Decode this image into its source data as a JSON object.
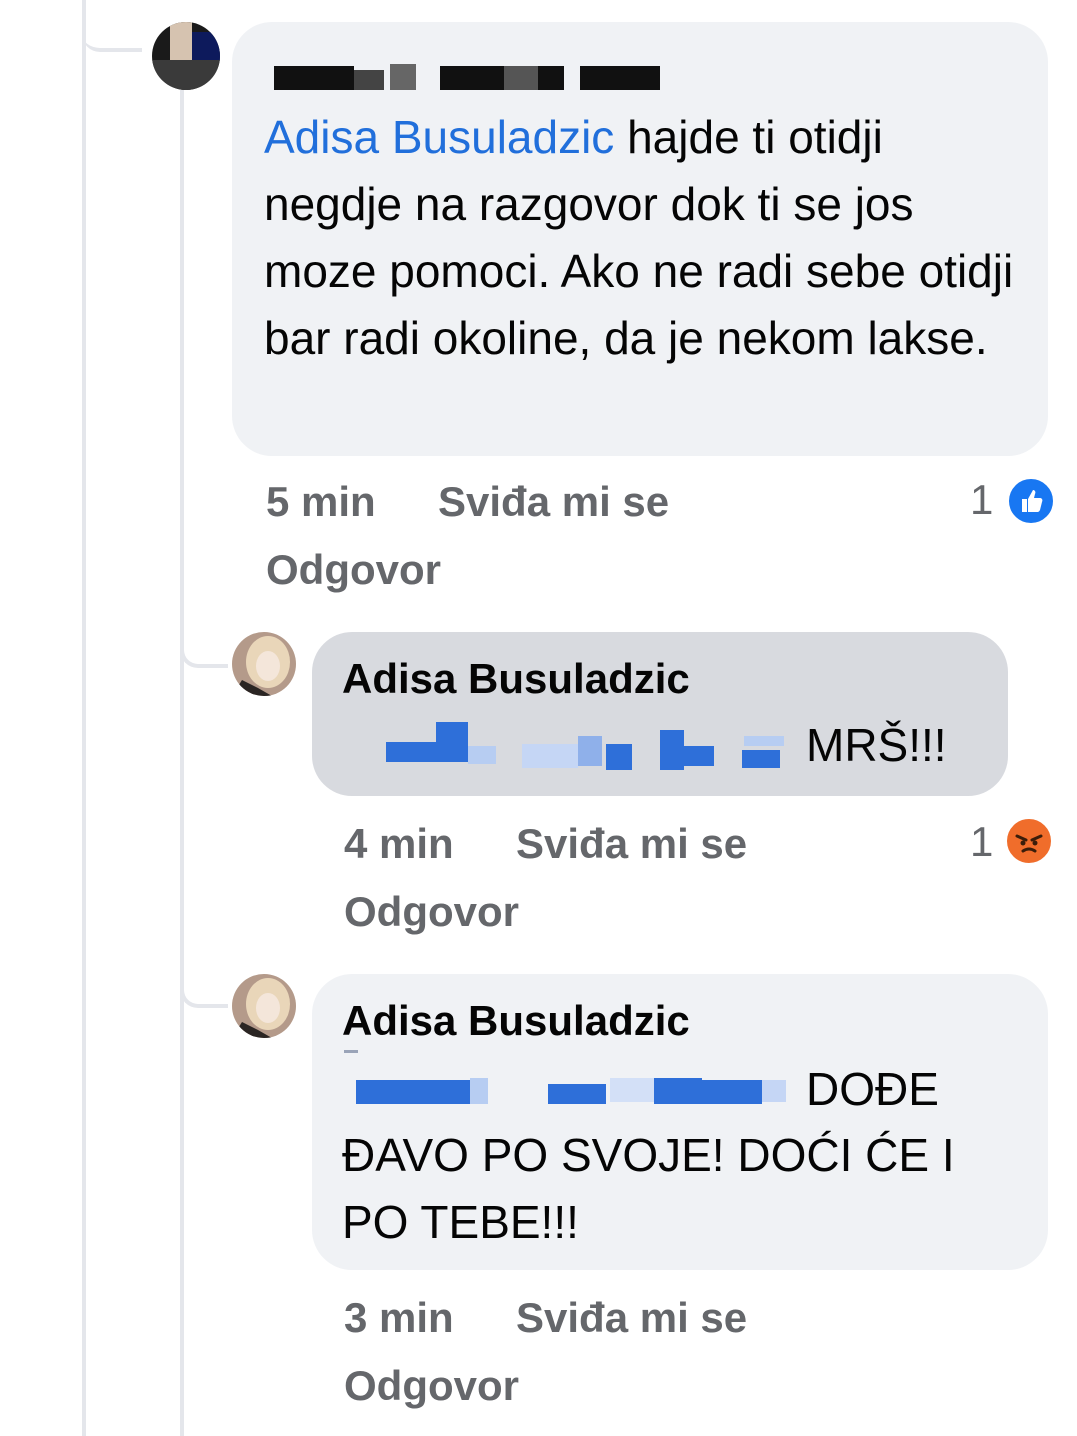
{
  "comments": [
    {
      "author": "",
      "mention": "Adisa Busuladzic",
      "text": "hajde ti otidji negdje na razgovor dok ti se jos moze pomoci. Ako ne radi sebe otidji bar radi okoline, da je nekom lakse.",
      "time": "5 min",
      "like_label": "Sviđa mi se",
      "reply_label": "Odgovor",
      "reaction_count": "1",
      "reaction_icon": "like-icon"
    },
    {
      "author": "Adisa Busuladzic",
      "text": "MRŠ!!!",
      "time": "4 min",
      "like_label": "Sviđa mi se",
      "reply_label": "Odgovor",
      "reaction_count": "1",
      "reaction_icon": "angry-icon"
    },
    {
      "author": "Adisa Busuladzic",
      "text_line1": "DOĐE",
      "text_rest": "ĐAVO PO SVOJE! DOĆI ĆE I PO TEBE!!!",
      "time": "3 min",
      "like_label": "Sviđa mi se",
      "reply_label": "Odgovor"
    }
  ],
  "colors": {
    "bubble": "#f0f2f5",
    "bubble_selected": "#d8dadf",
    "mention": "#216fdb",
    "meta": "#65676b",
    "like_blue": "#1877f2",
    "angry_orange": "#f06d2b",
    "censor_blue": "#2e6fd9",
    "censor_black": "#111111"
  }
}
